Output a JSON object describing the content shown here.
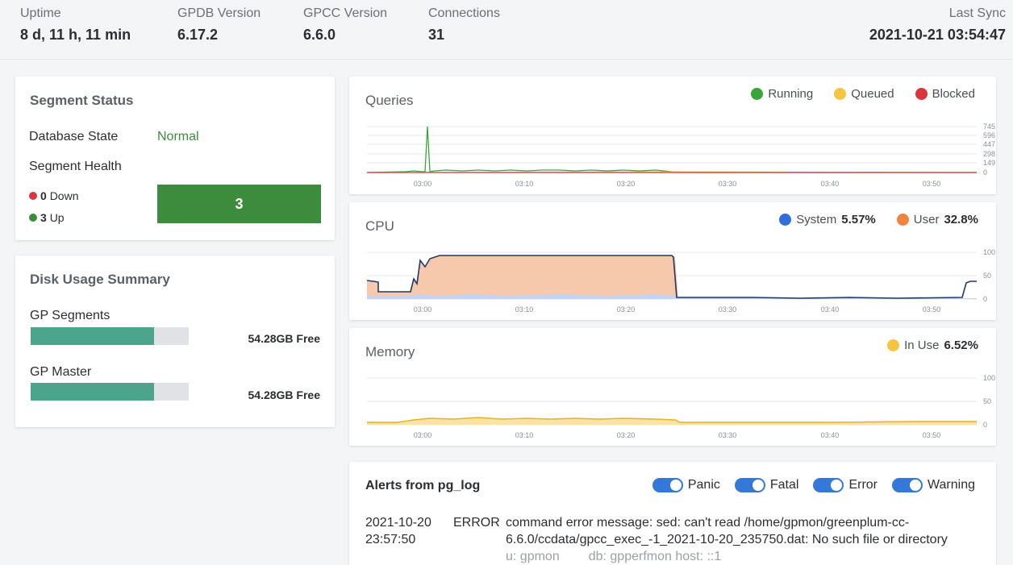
{
  "header": {
    "uptime": {
      "label": "Uptime",
      "value": "8 d, 11 h, 11 min"
    },
    "gpdb": {
      "label": "GPDB Version",
      "value": "6.17.2"
    },
    "gpcc": {
      "label": "GPCC Version",
      "value": "6.6.0"
    },
    "connections": {
      "label": "Connections",
      "value": "31"
    },
    "last_sync": {
      "label": "Last Sync",
      "value": "2021-10-21 03:54:47"
    }
  },
  "segment_status": {
    "title": "Segment Status",
    "db_state_label": "Database State",
    "db_state_value": "Normal",
    "health_label": "Segment Health",
    "down_count": "0",
    "down_label": "Down",
    "up_count": "3",
    "up_label": "Up",
    "health_bar_value": "3",
    "colors": {
      "down": "#d9363e",
      "up": "#3d8b3d"
    }
  },
  "disk_usage": {
    "title": "Disk Usage Summary",
    "items": [
      {
        "label": "GP Segments",
        "free": "54.28GB Free",
        "used_fraction": 0.78
      },
      {
        "label": "GP Master",
        "free": "54.28GB Free",
        "used_fraction": 0.78
      }
    ]
  },
  "queries": {
    "title": "Queries",
    "legend": [
      {
        "label": "Running",
        "color": "#3aa63a"
      },
      {
        "label": "Queued",
        "color": "#f5c542"
      },
      {
        "label": "Blocked",
        "color": "#d9363e"
      }
    ],
    "y_ticks": [
      "745",
      "596",
      "447",
      "298",
      "149",
      "0"
    ],
    "x_ticks": [
      "03:00",
      "03:10",
      "03:20",
      "03:30",
      "03:40",
      "03:50"
    ]
  },
  "cpu": {
    "title": "CPU",
    "legend": [
      {
        "label": "System",
        "value": "5.57%",
        "color": "#2f6fdb"
      },
      {
        "label": "User",
        "value": "32.8%",
        "color": "#f0843c"
      }
    ],
    "y_ticks": [
      "100",
      "50",
      "0"
    ],
    "x_ticks": [
      "03:00",
      "03:10",
      "03:20",
      "03:30",
      "03:40",
      "03:50"
    ]
  },
  "memory": {
    "title": "Memory",
    "legend": [
      {
        "label": "In Use",
        "value": "6.52%",
        "color": "#f5c542"
      }
    ],
    "y_ticks": [
      "100",
      "50",
      "0"
    ],
    "x_ticks": [
      "03:00",
      "03:10",
      "03:20",
      "03:30",
      "03:40",
      "03:50"
    ]
  },
  "alerts": {
    "title": "Alerts from pg_log",
    "toggles": [
      "Panic",
      "Fatal",
      "Error",
      "Warning"
    ],
    "entries": [
      {
        "date": "2021-10-20",
        "time": "23:57:50",
        "level": "ERROR",
        "message_line1": "command error message: sed: can't read /home/gpmon/greenplum-cc-",
        "message_line2": "6.6.0/ccdata/gpcc_exec_-1_2021-10-20_235750.dat: No such file or directory",
        "user": "u: gpmon",
        "db": "db: gpperfmon host: ::1"
      }
    ]
  }
}
